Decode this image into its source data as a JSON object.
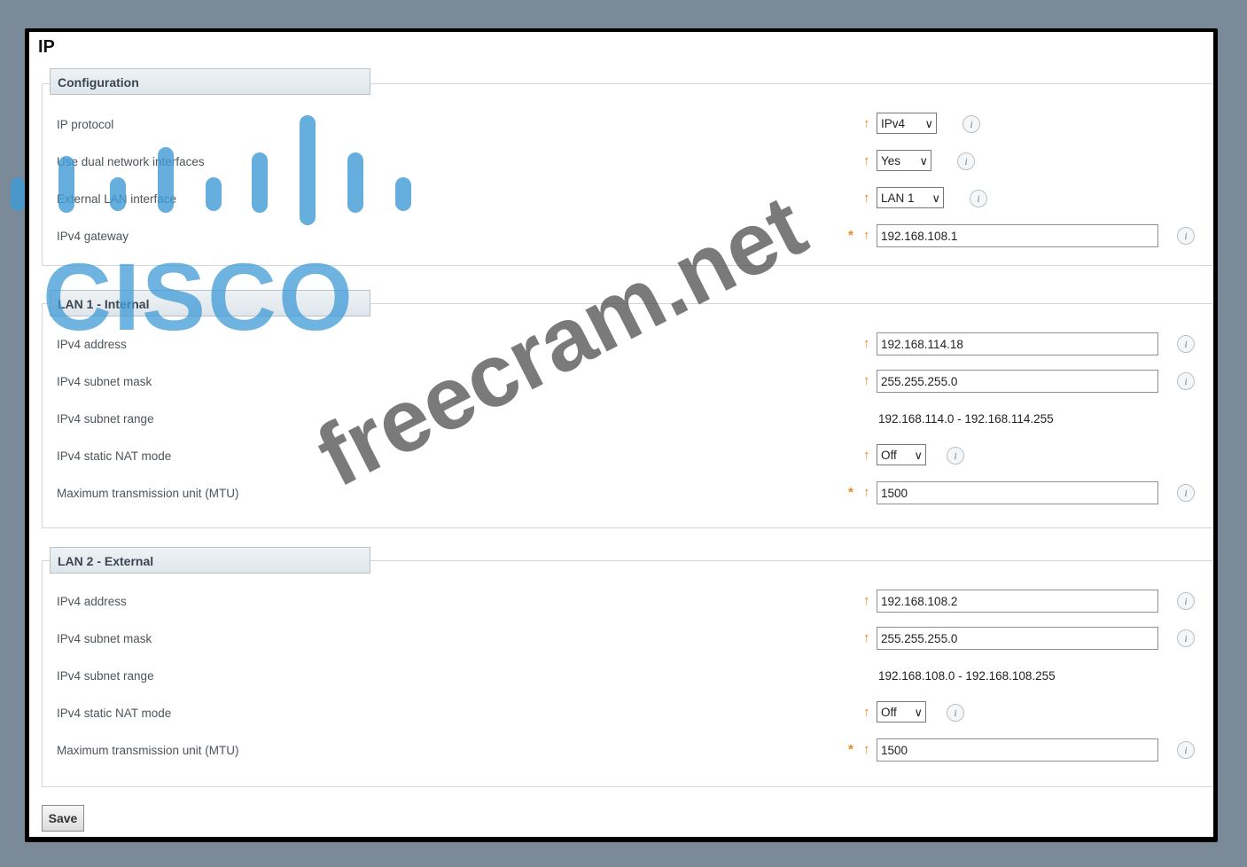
{
  "page_title": "IP",
  "sections": {
    "configuration": {
      "title": "Configuration",
      "rows": [
        {
          "label": "IP protocol",
          "value": "IPv4"
        },
        {
          "label": "Use dual network interfaces",
          "value": "Yes"
        },
        {
          "label": "External LAN interface",
          "value": "LAN 1"
        },
        {
          "label": "IPv4 gateway",
          "value": "192.168.108.1"
        }
      ]
    },
    "lan1": {
      "title": "LAN 1 - Internal",
      "rows": [
        {
          "label": "IPv4 address",
          "value": "192.168.114.18"
        },
        {
          "label": "IPv4 subnet mask",
          "value": "255.255.255.0"
        },
        {
          "label": "IPv4 subnet range",
          "value": "192.168.114.0 - 192.168.114.255"
        },
        {
          "label": "IPv4 static NAT mode",
          "value": "Off"
        },
        {
          "label": "Maximum transmission unit (MTU)",
          "value": "1500"
        }
      ]
    },
    "lan2": {
      "title": "LAN 2 - External",
      "rows": [
        {
          "label": "IPv4 address",
          "value": "192.168.108.2"
        },
        {
          "label": "IPv4 subnet mask",
          "value": "255.255.255.0"
        },
        {
          "label": "IPv4 subnet range",
          "value": "192.168.108.0 - 192.168.108.255"
        },
        {
          "label": "IPv4 static NAT mode",
          "value": "Off"
        },
        {
          "label": "Maximum transmission unit (MTU)",
          "value": "1500"
        }
      ]
    }
  },
  "marks": {
    "required": "*",
    "arrow": "↑",
    "info": "i",
    "chevron": "∨"
  },
  "save_label": "Save",
  "watermark": {
    "logo": "CISCO",
    "site": "freecram.net"
  },
  "colors": {
    "accent_mark": "#e58a1f",
    "logo_blue": "#3f9bd7"
  }
}
